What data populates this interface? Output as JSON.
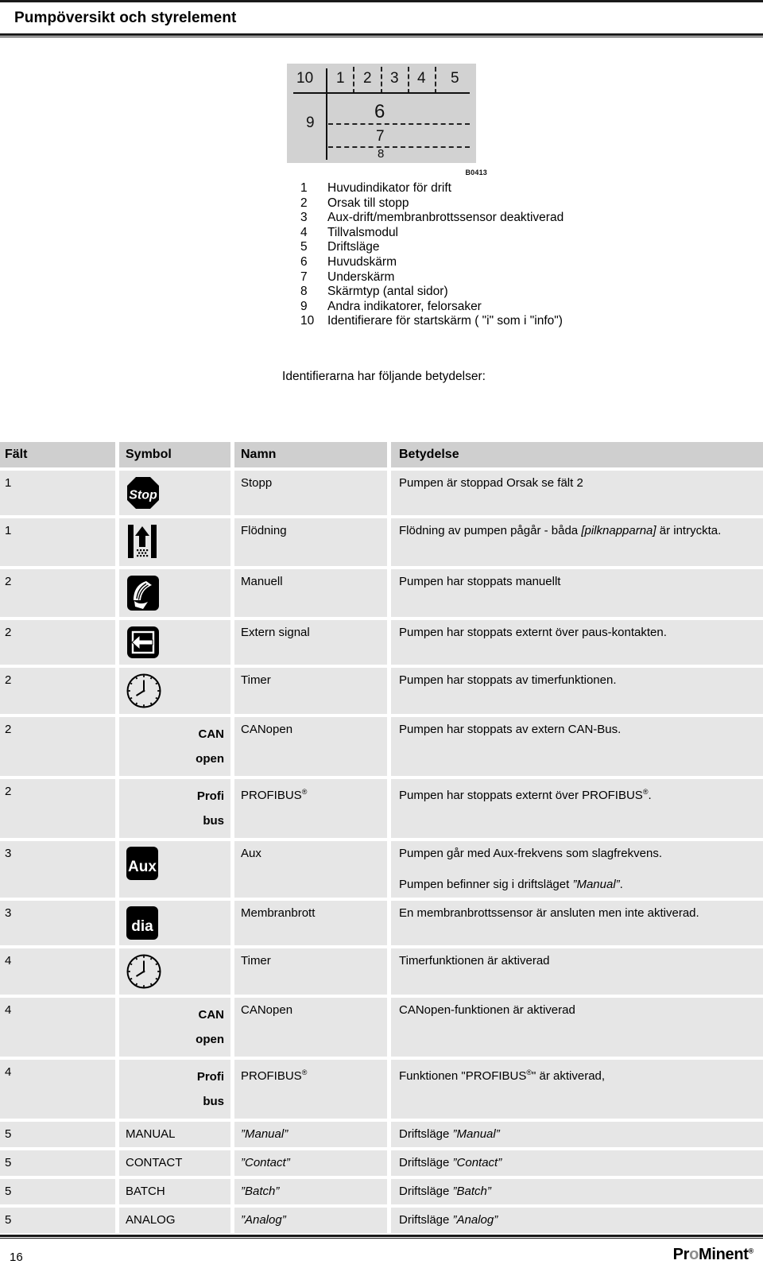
{
  "header": {
    "title": "Pumpöversikt och styrelement"
  },
  "figure": {
    "caption_id": "B0413",
    "top_labels": [
      "10",
      "1",
      "2",
      "3",
      "4",
      "5"
    ],
    "side_label": "9",
    "main_label": "6",
    "sub_label": "7",
    "type_label": "8"
  },
  "legend": {
    "items": [
      {
        "num": "1",
        "text": "Huvudindikator för drift"
      },
      {
        "num": "2",
        "text": "Orsak till stopp"
      },
      {
        "num": "3",
        "text": "Aux-drift/membranbrottssensor deaktiverad"
      },
      {
        "num": "4",
        "text": "Tillvalsmodul"
      },
      {
        "num": "5",
        "text": "Driftsläge"
      },
      {
        "num": "6",
        "text": "Huvudskärm"
      },
      {
        "num": "7",
        "text": "Underskärm"
      },
      {
        "num": "8",
        "text": "Skärmtyp (antal sidor)"
      },
      {
        "num": "9",
        "text": "Andra indikatorer, felorsaker"
      },
      {
        "num": "10",
        "text": "Identifierare för startskärm ( \"i\" som i \"info\")"
      }
    ]
  },
  "intro": {
    "text": "Identifierarna har följande betydelser:"
  },
  "table": {
    "columns": [
      "Fält",
      "Symbol",
      "Namn",
      "Betydelse"
    ],
    "rows": [
      {
        "falt": "1",
        "symbol_icon": "stop-sign-icon",
        "symbol_text": "",
        "namn": "Stopp",
        "bety": "Pumpen är stoppad Orsak se fält 2"
      },
      {
        "falt": "1",
        "symbol_icon": "priming-arrow-icon",
        "symbol_text": "",
        "namn": "Flödning",
        "bety_pre": "Flödning av pumpen pågår - båda ",
        "bety_ital": "[pilknapparna]",
        "bety_post": " är intryckta."
      },
      {
        "falt": "2",
        "symbol_icon": "hand-icon",
        "symbol_text": "",
        "namn": "Manuell",
        "bety": "Pumpen har stoppats manuellt"
      },
      {
        "falt": "2",
        "symbol_icon": "external-signal-icon",
        "symbol_text": "",
        "namn": "Extern signal",
        "bety": "Pumpen har stoppats externt över paus-kontakten."
      },
      {
        "falt": "2",
        "symbol_icon": "clock-icon",
        "symbol_text": "",
        "namn": "Timer",
        "bety": "Pumpen har stoppats av timerfunktionen."
      },
      {
        "falt": "2",
        "symbol_icon": "",
        "symbol_text": "CAN\nopen",
        "namn": "CANopen",
        "bety": "Pumpen har stoppats av extern CAN-Bus."
      },
      {
        "falt": "2",
        "symbol_icon": "",
        "symbol_text": "Profi\nbus",
        "namn": "PROFIBUS",
        "namn_reg": "®",
        "bety_pre": "Pumpen har stoppats externt över PROFIBUS",
        "bety_reg": "®",
        "bety_post": "."
      },
      {
        "falt": "3",
        "symbol_icon": "aux-badge-icon",
        "symbol_text": "Aux",
        "namn": "Aux",
        "bety": "Pumpen går med Aux-frekvens som slagfrekvens.",
        "bety2_pre": "Pumpen befinner sig i driftsläget ",
        "bety2_ital": "”Manual”",
        "bety2_post": "."
      },
      {
        "falt": "3",
        "symbol_icon": "dia-badge-icon",
        "symbol_text": "dia",
        "namn": "Membranbrott",
        "bety": "En membranbrottssensor är ansluten men inte aktiverad."
      },
      {
        "falt": "4",
        "symbol_icon": "clock-icon",
        "symbol_text": "",
        "namn": "Timer",
        "bety": "Timerfunktionen är aktiverad"
      },
      {
        "falt": "4",
        "symbol_icon": "",
        "symbol_text": "CAN\nopen",
        "namn": "CANopen",
        "bety": "CANopen-funktionen är aktiverad"
      },
      {
        "falt": "4",
        "symbol_icon": "",
        "symbol_text": "Profi\nbus",
        "namn": "PROFIBUS",
        "namn_reg": "®",
        "bety_pre": "Funktionen \"PROFIBUS",
        "bety_reg": "®",
        "bety_post": "\" är aktiverad,"
      },
      {
        "falt": "5",
        "symbol_icon": "",
        "symbol_text": "MANUAL",
        "namn": "”Manual”",
        "namn_ital": true,
        "bety_pre": "Driftsläge ",
        "bety_ital": "”Manual”"
      },
      {
        "falt": "5",
        "symbol_icon": "",
        "symbol_text": "CONTACT",
        "namn": "”Contact”",
        "namn_ital": true,
        "bety_pre": "Driftsläge ",
        "bety_ital": "”Contact”"
      },
      {
        "falt": "5",
        "symbol_icon": "",
        "symbol_text": "BATCH",
        "namn": "”Batch”",
        "namn_ital": true,
        "bety_pre": "Driftsläge ",
        "bety_ital": "”Batch”"
      },
      {
        "falt": "5",
        "symbol_icon": "",
        "symbol_text": "ANALOG",
        "namn": "”Analog”",
        "namn_ital": true,
        "bety_pre": "Driftsläge ",
        "bety_ital": "”Analog”"
      }
    ]
  },
  "footer": {
    "page_number": "16",
    "brand_pre": "Pr",
    "brand_o": "o",
    "brand_post": "Minent",
    "brand_reg": "®"
  }
}
